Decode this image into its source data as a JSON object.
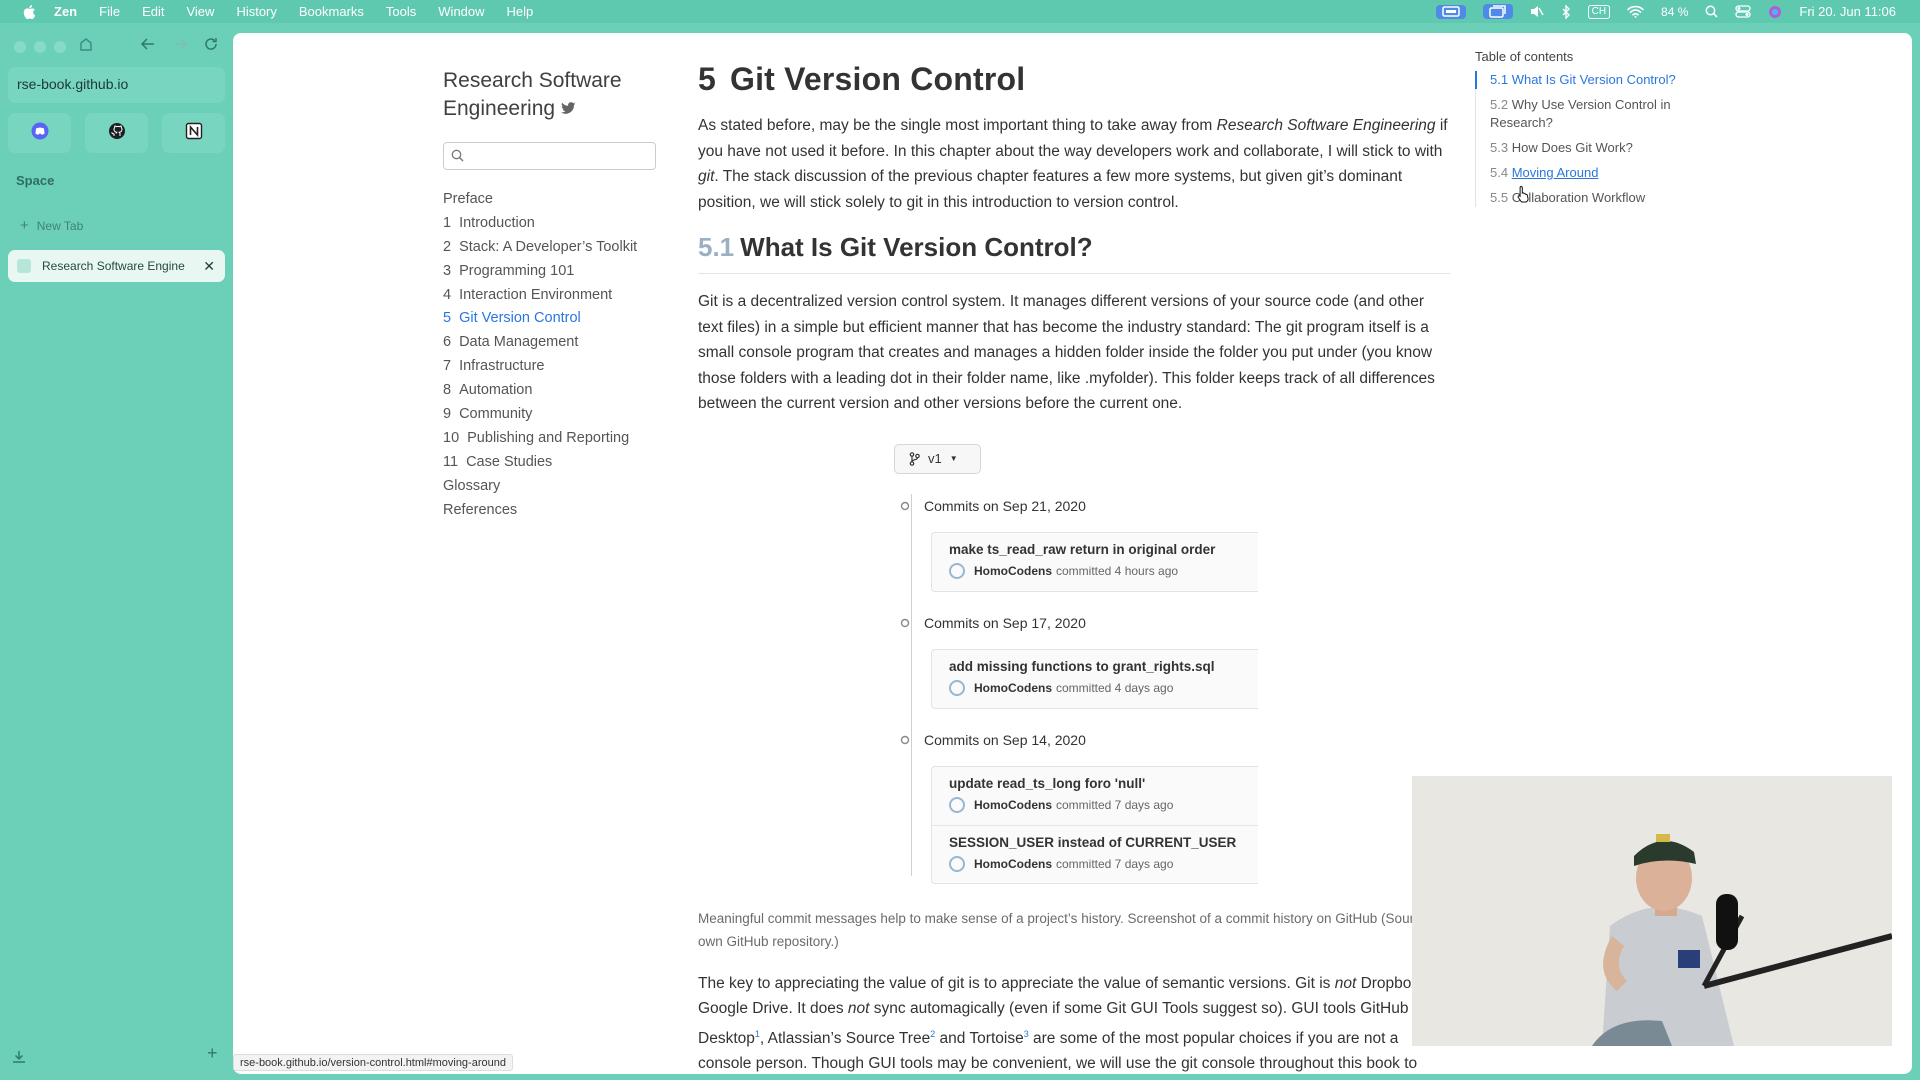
{
  "menubar": {
    "app_name": "Zen",
    "menus": [
      "File",
      "Edit",
      "View",
      "History",
      "Bookmarks",
      "Tools",
      "Window",
      "Help"
    ],
    "battery": "84 %",
    "input_source": "CH",
    "datetime": "Fri 20. Jun  11:06"
  },
  "browser": {
    "url": "rse-book.github.io",
    "space_label": "Space",
    "new_tab_label": "New Tab",
    "active_tab_title": "Research Software Engine",
    "status_url": "rse-book.github.io/version-control.html#moving-around"
  },
  "site": {
    "title_line1": "Research Software",
    "title_line2": "Engineering",
    "search_placeholder": "",
    "nav": [
      {
        "num": "",
        "label": "Preface"
      },
      {
        "num": "1",
        "label": "Introduction"
      },
      {
        "num": "2",
        "label": "Stack: A Developer’s Toolkit"
      },
      {
        "num": "3",
        "label": "Programming 101"
      },
      {
        "num": "4",
        "label": "Interaction Environment"
      },
      {
        "num": "5",
        "label": "Git Version Control"
      },
      {
        "num": "6",
        "label": "Data Management"
      },
      {
        "num": "7",
        "label": "Infrastructure"
      },
      {
        "num": "8",
        "label": "Automation"
      },
      {
        "num": "9",
        "label": "Community"
      },
      {
        "num": "10",
        "label": "Publishing and Reporting"
      },
      {
        "num": "11",
        "label": "Case Studies"
      },
      {
        "num": "",
        "label": "Glossary"
      },
      {
        "num": "",
        "label": "References"
      }
    ]
  },
  "article": {
    "chapter_num": "5",
    "chapter_title": "Git Version Control",
    "intro": {
      "a": "As stated before, may be the single most important thing to take away from ",
      "em1": "Research Software Engineering",
      "b": " if you have not used it before. In this chapter about the way developers work and collaborate, I will stick to with ",
      "em2": "git",
      "c": ". The stack discussion of the previous chapter features a few more systems, but given git’s dominant position, we will stick solely to git in this introduction to version control."
    },
    "section_num": "5.1",
    "section_title": "What Is Git Version Control?",
    "para2": "Git is a decentralized version control system. It manages different versions of your source code (and other text files) in a simple but efficient manner that has become the industry standard: The git program itself is a small console program that creates and manages a hidden folder inside the folder you put under (you know those folders with a leading dot in their folder name, like .myfolder). This folder keeps track of all differences between the current version and other versions before the current one.",
    "caption": "Meaningful commit messages help to make sense of a project’s history. Screenshot of a commit history on GitHub (Source: own GitHub repository.)",
    "para3": {
      "a": "The key to appreciating the value of git is to appreciate the value of semantic versions. Git is ",
      "em1": "not",
      "b": " Dropbox nor Google Drive. It does ",
      "em2": "not",
      "c": " sync automagically (even if some Git GUI Tools suggest so). GUI tools GitHub Desktop",
      "sup1": "1",
      "d": ", Atlassian’s Source Tree",
      "sup2": "2",
      "e": " and Tortoise",
      "sup3": "3",
      "f": " are some of the most popular choices if you are not a console person. Though GUI tools may be convenient, we will use the git console throughout this book to"
    }
  },
  "commit_history": {
    "branch": "v1",
    "groups": [
      {
        "date": "Commits on Sep 21, 2020",
        "commits": [
          {
            "message": "make ts_read_raw return in original order",
            "author": "HomoCodens",
            "time": "committed 4 hours ago"
          }
        ]
      },
      {
        "date": "Commits on Sep 17, 2020",
        "commits": [
          {
            "message": "add missing functions to grant_rights.sql",
            "author": "HomoCodens",
            "time": "committed 4 days ago"
          }
        ]
      },
      {
        "date": "Commits on Sep 14, 2020",
        "commits": [
          {
            "message": "update read_ts_long foro 'null'",
            "author": "HomoCodens",
            "time": "committed 7 days ago"
          },
          {
            "message": "SESSION_USER instead of CURRENT_USER",
            "author": "HomoCodens",
            "time": "committed 7 days ago"
          }
        ]
      }
    ]
  },
  "toc": {
    "title": "Table of contents",
    "items": [
      {
        "num": "5.1",
        "label": "What Is Git Version Control?"
      },
      {
        "num": "5.2",
        "label": "Why Use Version Control in Research?"
      },
      {
        "num": "5.3",
        "label": "How Does Git Work?"
      },
      {
        "num": "5.4",
        "label": "Moving Around"
      },
      {
        "num": "5.5",
        "label": "Collaboration Workflow"
      }
    ]
  },
  "icons": {
    "menubar_right": [
      "screen-mirroring-icon",
      "screen-share-icon",
      "mute-icon",
      "bluetooth-icon",
      "wifi-icon",
      "search-icon",
      "control-center-icon",
      "siri-icon"
    ],
    "pinned": [
      "discord-icon",
      "github-icon",
      "notion-icon"
    ]
  },
  "colors": {
    "accent_link": "#2a76dd",
    "browser_frame": "#6ccfb8",
    "section_number": "#9bb0c5"
  }
}
